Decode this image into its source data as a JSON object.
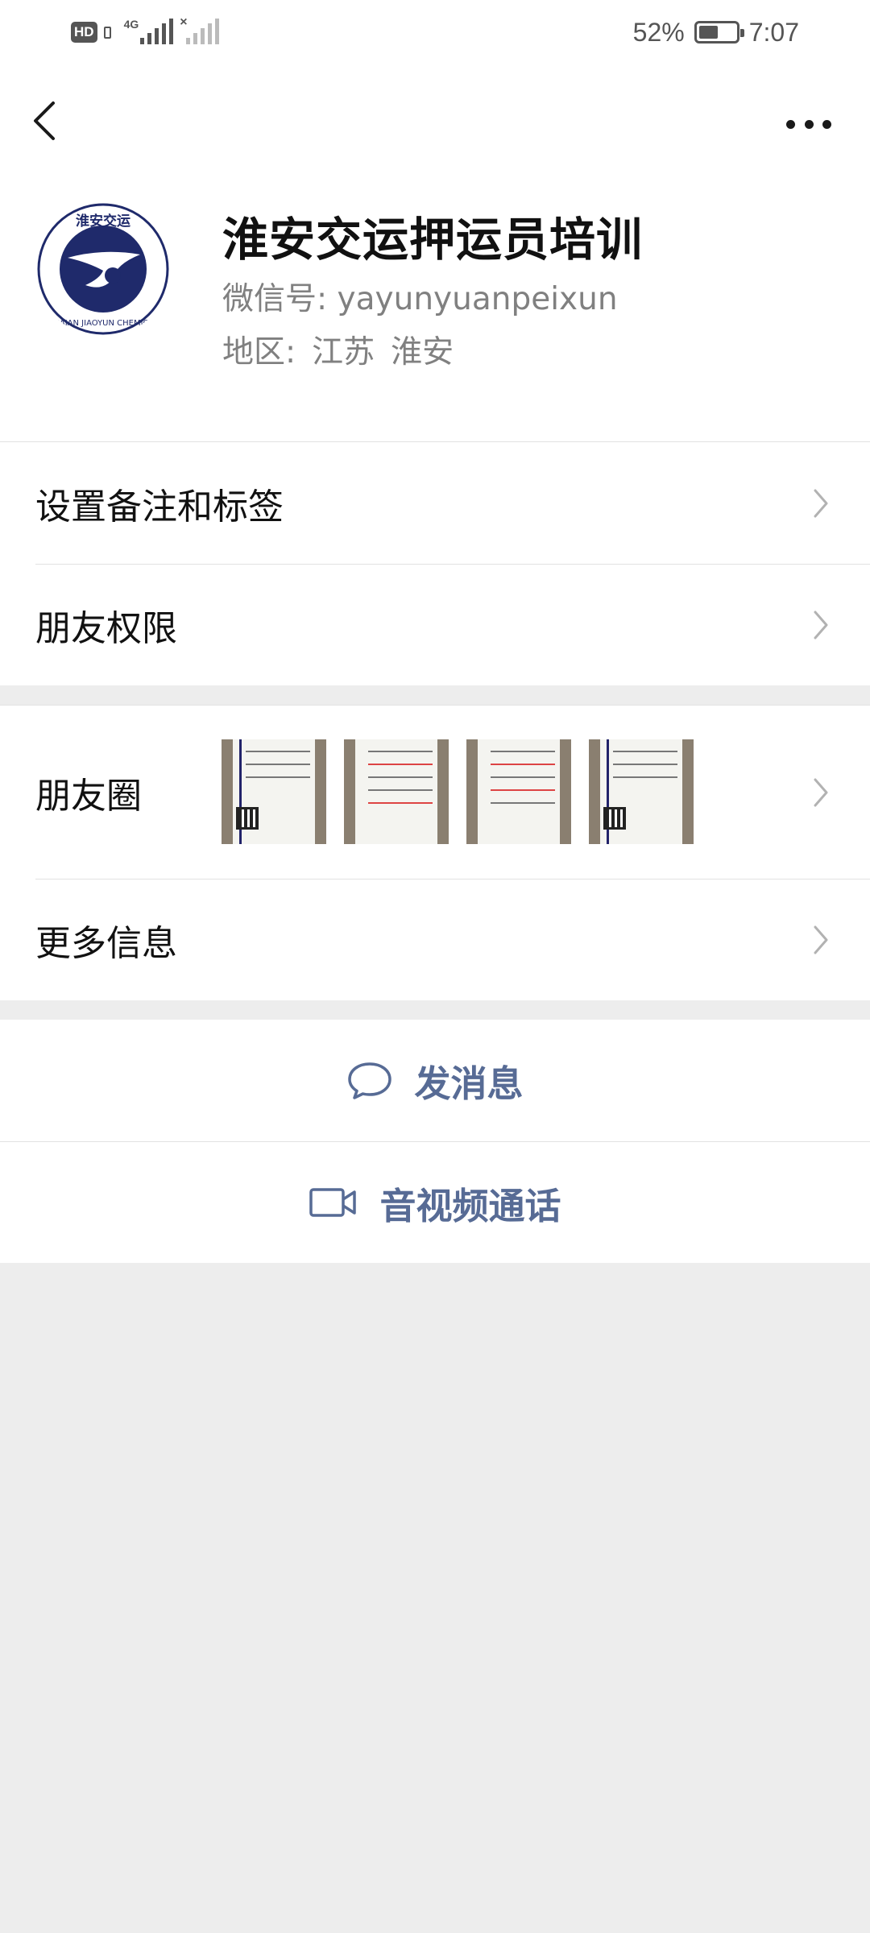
{
  "status_bar": {
    "hd_label": "HD",
    "network_type": "4G",
    "battery_level": 0.52,
    "battery_text": "52%",
    "time": "7:07"
  },
  "nav": {
    "back_icon": "chevron-left-icon",
    "more_icon": "more-dots-icon"
  },
  "profile": {
    "name": "淮安交运押运员培训",
    "wechat_id": "微信号: yayunyuanpeixun",
    "region_label": "地区:",
    "region_province": "江苏",
    "region_city": "淮安",
    "avatar_logo_text_top": "淮安交运",
    "avatar_logo_text_bottom": "HUAIAN JIAOYUN CHEMICAL"
  },
  "settings": {
    "remark_label": "设置备注和标签",
    "permissions_label": "朋友权限"
  },
  "moments": {
    "label": "朋友圈",
    "thumbnail_count": 4
  },
  "more_info": {
    "label": "更多信息"
  },
  "actions": {
    "message_label": "发消息",
    "call_label": "音视频通话"
  },
  "colors": {
    "link_blue": "#576b95",
    "background": "#ededed",
    "logo_navy": "#1f2a6b"
  }
}
